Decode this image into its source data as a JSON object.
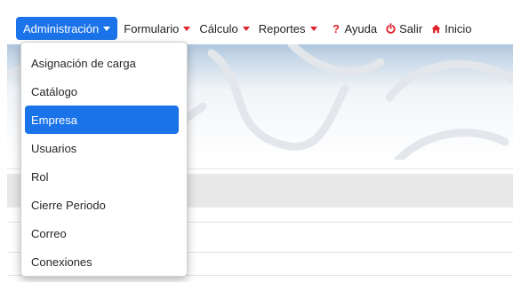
{
  "navbar": {
    "items": [
      {
        "label": "Administración",
        "has_caret": true,
        "active": true
      },
      {
        "label": "Formulario",
        "has_caret": true
      },
      {
        "label": "Cálculo",
        "has_caret": true
      },
      {
        "label": "Reportes",
        "has_caret": true
      },
      {
        "label": "Ayuda",
        "icon": "question-icon"
      },
      {
        "label": "Salir",
        "icon": "power-icon"
      },
      {
        "label": "Inicio",
        "icon": "home-icon"
      }
    ]
  },
  "dropdown": {
    "items": [
      {
        "label": "Asignación de carga"
      },
      {
        "label": "Catálogo"
      },
      {
        "label": "Empresa",
        "selected": true
      },
      {
        "label": "Usuarios"
      },
      {
        "label": "Rol"
      },
      {
        "label": "Cierre Periodo"
      },
      {
        "label": "Correo"
      },
      {
        "label": "Conexiones"
      }
    ]
  },
  "colors": {
    "accent": "#1a73e8",
    "caret_red": "#e0212a",
    "banner_top": "#aec6dd"
  }
}
